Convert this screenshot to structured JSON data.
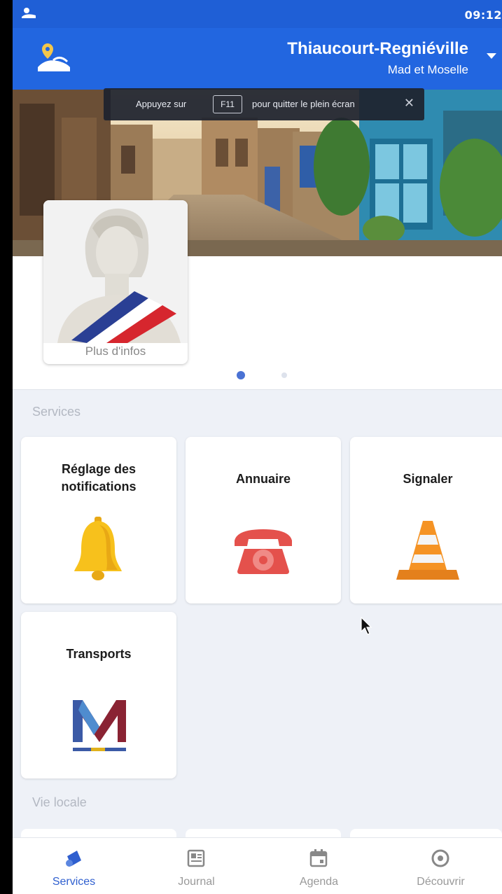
{
  "status_bar": {
    "time": "09:12"
  },
  "header": {
    "title": "Thiaucourt-Regniéville",
    "subtitle": "Mad et Moselle"
  },
  "fullscreen_toast": {
    "prefix": "Appuyez sur",
    "key": "F11",
    "suffix": "pour quitter le plein écran"
  },
  "profile_card": {
    "more_label": "Plus d'infos"
  },
  "carousel": {
    "pages": 2,
    "active_index": 0
  },
  "sections": {
    "services": "Services",
    "local_life": "Vie locale"
  },
  "services": [
    {
      "label_line1": "Réglage des",
      "label_line2": "notifications",
      "icon": "bell-icon"
    },
    {
      "label_line1": "Annuaire",
      "label_line2": "",
      "icon": "telephone-icon"
    },
    {
      "label_line1": "Signaler",
      "label_line2": "",
      "icon": "traffic-cone-icon"
    },
    {
      "label_line1": "Transports",
      "label_line2": "",
      "icon": "transport-logo-icon"
    }
  ],
  "bottom_nav": [
    {
      "label": "Services",
      "icon": "services-icon",
      "active": true
    },
    {
      "label": "Journal",
      "icon": "newspaper-icon",
      "active": false
    },
    {
      "label": "Agenda",
      "icon": "calendar-icon",
      "active": false
    },
    {
      "label": "Découvrir",
      "icon": "compass-icon",
      "active": false
    }
  ],
  "colors": {
    "primary": "#2266e0",
    "status_bar": "#1f5fd6",
    "active_nav": "#2f5fcf",
    "background": "#eef1f7"
  }
}
